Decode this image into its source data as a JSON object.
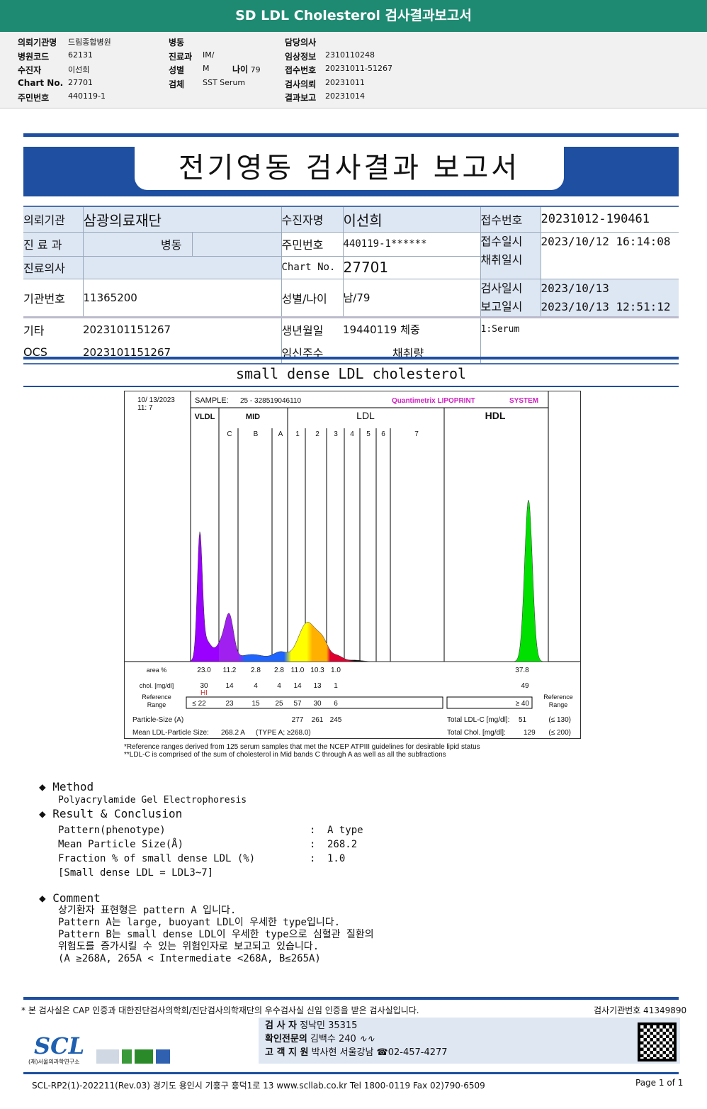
{
  "top_title": "SD LDL Cholesterol 검사결과보고서",
  "header": {
    "col1": [
      [
        "의뢰기관명",
        "드림종합병원"
      ],
      [
        "병원코드",
        "62131"
      ],
      [
        "수진자",
        "이선희"
      ],
      [
        "Chart No.",
        "27701"
      ],
      [
        "주민번호",
        "440119-1"
      ]
    ],
    "col2": [
      [
        "병동",
        ""
      ],
      [
        "진료과",
        "IM/"
      ],
      [
        "성별",
        "M"
      ],
      [
        "검체",
        "SST Serum"
      ]
    ],
    "age_label": "나이",
    "age_value": "79",
    "col3": [
      [
        "담당의사",
        ""
      ],
      [
        "임상정보",
        "2310110248"
      ],
      [
        "접수번호",
        "20231011-51267"
      ],
      [
        "검사의뢰",
        "20231011"
      ],
      [
        "결과보고",
        "20231014"
      ]
    ]
  },
  "report_title": "전기영동 검사결과 보고서",
  "info": {
    "institution_label": "의뢰기관",
    "institution": "삼광의료재단",
    "dept_label": "진 료 과",
    "ward_label": "병동",
    "doctor_label": "진료의사",
    "inst_no_label": "기관번호",
    "inst_no": "11365200",
    "etc_label": "기타",
    "etc": "2023101151267",
    "ocs_label": "OCS",
    "ocs": "2023101151267",
    "patient_label": "수진자명",
    "patient": "이선희",
    "rrn_label": "주민번호",
    "rrn": "440119-1******",
    "chart_label": "Chart No.",
    "chart": "27701",
    "sexage_label": "성별/나이",
    "sexage": "남/79",
    "birth_label": "생년월일",
    "birth": "19440119",
    "weight_label": "체중",
    "preg_label": "임신주수",
    "volume_label": "채취량",
    "receipt_no_label": "접수번호",
    "receipt_no": "20231012-190461",
    "receipt_dt_label": "접수일시",
    "receipt_dt": "2023/10/12 16:14:08",
    "collect_label": "채취일시",
    "test_dt_label": "검사일시",
    "test_dt": "2023/10/13",
    "report_dt_label": "보고일시",
    "report_dt": "2023/10/13 12:51:12",
    "specimen": "1:Serum"
  },
  "section_title": "small dense LDL cholesterol",
  "lipoprint": {
    "date": "10/ 13/2023",
    "time": "11:  7",
    "sample_label": "SAMPLE:",
    "sample": "25 - 328519046110",
    "brand": "Quantimetrix LIPOPRINT",
    "brand_tail": "SYSTEM",
    "bands": {
      "vldl": "VLDL",
      "mid": "MID",
      "ldl": "LDL",
      "hdl": "HDL"
    },
    "subbands": [
      "C",
      "B",
      "A",
      "1",
      "2",
      "3",
      "4",
      "5",
      "6",
      "7"
    ],
    "area_label": "area %",
    "area": [
      "23.0",
      "11.2",
      "2.8",
      "2.8",
      "11.0",
      "10.3",
      "1.0"
    ],
    "area_hdl": "37.8",
    "chol_label": "chol. [mg/dl]",
    "chol": [
      "30",
      "14",
      "4",
      "4",
      "14",
      "13",
      "1"
    ],
    "chol_hdl": "49",
    "hi_flag": "HI",
    "ref_label": "Reference Range",
    "ref": [
      "≤ 22",
      "23",
      "15",
      "25",
      "57",
      "30",
      "6"
    ],
    "ref_hdl": "≥  40",
    "ps_label": "Particle-Size (A)",
    "ps": [
      "277",
      "261",
      "245"
    ],
    "mean_label": "Mean LDL-Particle Size:",
    "mean": "268.2  A",
    "mean_type": "(TYPE A; ≥268.0)",
    "tldl_label": "Total LDL-C [mg/dl]:",
    "tldl": "51",
    "tldl_ref": "(≤ 130)",
    "tchol_label": "Total Chol. [mg/dl]:",
    "tchol": "129",
    "tchol_ref": "(≤ 200)",
    "colors": {
      "vldl": "#9a00ff",
      "mid": "#a020f0",
      "midA": "#1e64ff",
      "ldl1": "#ffff00",
      "ldl2": "#ffb000",
      "ldl3": "#e00030",
      "hdl": "#00e000"
    }
  },
  "notes": [
    "*Reference ranges derived from 125 serum samples that met the NCEP ATPIII guidelines for desirable lipid status",
    "**LDL-C is comprised of the sum of cholesterol in Mid bands C through A as well as all the subfractions"
  ],
  "method": {
    "title": "Method",
    "text": "Polyacrylamide Gel Electrophoresis"
  },
  "result": {
    "title": "Result & Conclusion",
    "rows": [
      [
        "Pattern(phenotype)",
        ":",
        "A type"
      ],
      [
        "Mean Particle Size(Å)",
        ":",
        "268.2"
      ],
      [
        "Fraction % of small dense LDL (%)",
        ":",
        "1.0"
      ]
    ],
    "note": "[Small dense LDL = LDL3~7]"
  },
  "comment": {
    "title": "Comment",
    "lines": [
      "상기환자 표현형은 pattern A 입니다.",
      "Pattern A는 large, buoyant LDL이 우세한 type입니다.",
      "Pattern B는 small dense LDL이 우세한 type으로 심혈관 질환의",
      "위험도를 증가시킬 수 있는 위험인자로 보고되고 있습니다.",
      "(A ≥268A, 265A < Intermediate <268A, B≤265A)"
    ]
  },
  "footer": {
    "cert": "* 본 검사실은 CAP 인증과 대한진단검사의학회/진단검사의학재단의 우수검사실 신임 인증을 받은 검사실입니다.",
    "lab_no": "검사기관번호 41349890",
    "examiner_label": "검   사   자",
    "examiner": "정낙민 35315",
    "confirm_label": "확인전문의",
    "confirm": "김백수 240",
    "support_label": "고 객 지 원",
    "support": "박사현 서울강남 ☎02-457-4277",
    "logo": "SCL",
    "logo_sub": "(재)서울의과학연구소",
    "address": "SCL-RP2(1)-202211(Rev.03)  경기도 용인시 기흥구 흥덕1로 13  www.scllab.co.kr  Tel 1800-0119  Fax 02)790-6509",
    "page": "Page 1 of 1"
  }
}
